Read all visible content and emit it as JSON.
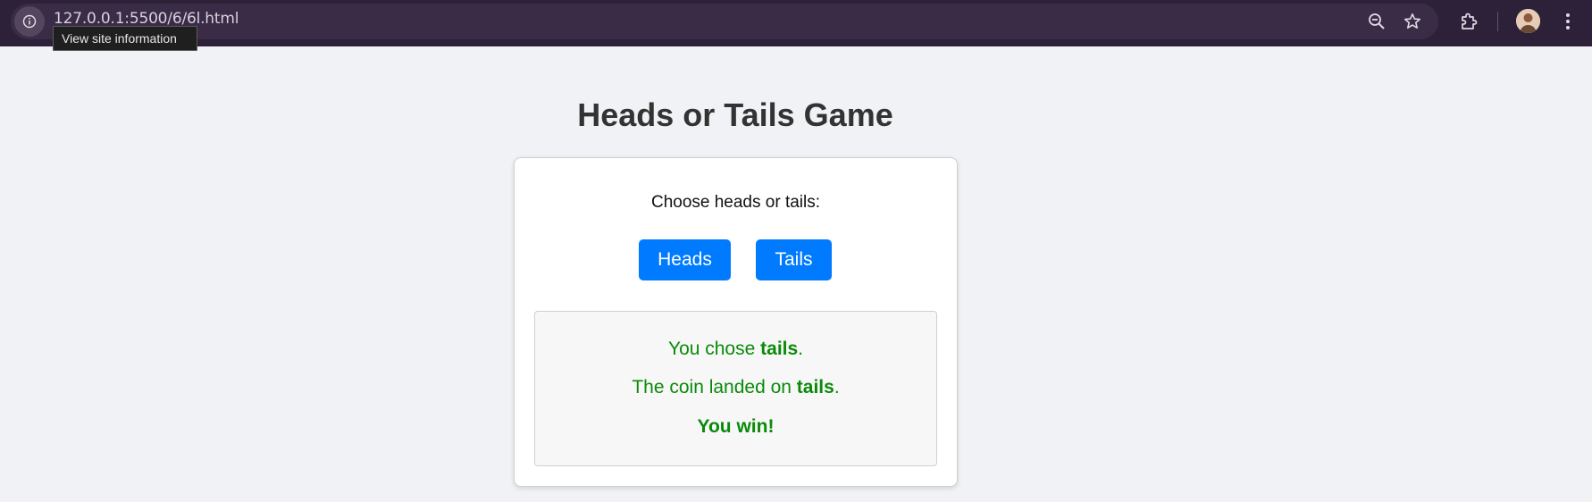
{
  "browser": {
    "url": "127.0.0.1:5500/6/6l.html",
    "tooltip": "View site information",
    "icons": [
      "info-icon",
      "zoom-out-icon",
      "star-icon",
      "extensions-icon",
      "avatar",
      "menu-icon"
    ]
  },
  "page": {
    "title": "Heads or Tails Game",
    "prompt": "Choose heads or tails:",
    "buttons": {
      "heads": "Heads",
      "tails": "Tails"
    },
    "colors": {
      "button": "#007bff",
      "result_text": "#0a8a0a"
    }
  },
  "result": {
    "chose_prefix": "You chose ",
    "chose_value": "tails",
    "chose_suffix": ".",
    "landed_prefix": "The coin landed on ",
    "landed_value": "tails",
    "landed_suffix": ".",
    "outcome": "You win!"
  }
}
